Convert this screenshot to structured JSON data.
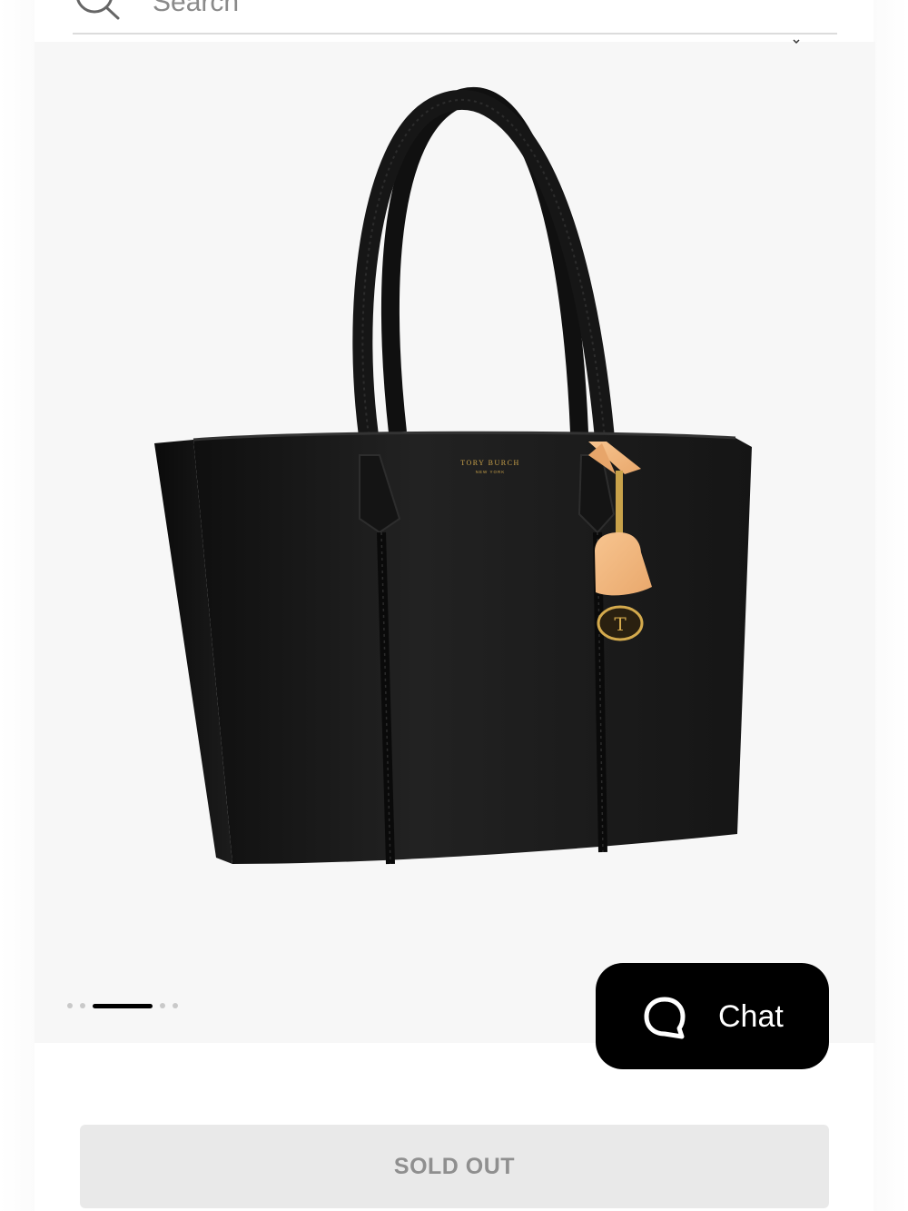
{
  "search": {
    "placeholder": "Search"
  },
  "product": {
    "brand_stamp": "TORY BURCH",
    "brand_sub": "NEW YORK"
  },
  "carousel": {
    "slides": 5,
    "active_index": 2
  },
  "chat": {
    "label": "Chat"
  },
  "cta": {
    "label": "SOLD OUT"
  },
  "colors": {
    "gallery_bg": "#f7f7f7",
    "bag": "#1a1a1a",
    "tag": "#f2b47a",
    "hardware_gold": "#c9a24a",
    "chat_bg": "#000000",
    "sold_out_bg": "#e9e9e9",
    "sold_out_text": "#8f8f8f"
  }
}
